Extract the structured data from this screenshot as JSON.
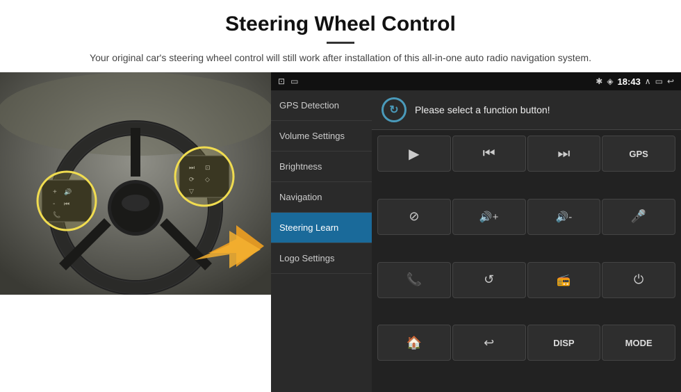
{
  "page": {
    "title": "Steering Wheel Control",
    "divider": true,
    "description": "Your original car's steering wheel control will still work after installation of this all-in-one auto radio navigation system."
  },
  "status_bar": {
    "left_icons": [
      "⊡",
      "⬜"
    ],
    "bluetooth_icon": "⚡",
    "wifi_icon": "◈",
    "time": "18:43",
    "up_icon": "∧",
    "battery_icon": "▭",
    "back_icon": "↩"
  },
  "sidebar": {
    "items": [
      {
        "label": "GPS Detection",
        "active": false
      },
      {
        "label": "Volume Settings",
        "active": false
      },
      {
        "label": "Brightness",
        "active": false
      },
      {
        "label": "Navigation",
        "active": false
      },
      {
        "label": "Steering Learn",
        "active": true
      },
      {
        "label": "Logo Settings",
        "active": false
      }
    ]
  },
  "function_panel": {
    "header_text": "Please select a function button!",
    "refresh_symbol": "↻",
    "buttons": [
      {
        "symbol": "▶",
        "type": "icon"
      },
      {
        "symbol": "⏮",
        "type": "icon"
      },
      {
        "symbol": "⏭",
        "type": "icon"
      },
      {
        "symbol": "GPS",
        "type": "text"
      },
      {
        "symbol": "🚫",
        "type": "icon"
      },
      {
        "symbol": "🔊+",
        "type": "icon"
      },
      {
        "symbol": "🔊-",
        "type": "icon"
      },
      {
        "symbol": "🎤",
        "type": "icon"
      },
      {
        "symbol": "📞",
        "type": "icon"
      },
      {
        "symbol": "↺",
        "type": "icon"
      },
      {
        "symbol": "📻",
        "type": "icon"
      },
      {
        "symbol": "⏻",
        "type": "icon"
      },
      {
        "symbol": "🏠",
        "type": "icon"
      },
      {
        "symbol": "↩",
        "type": "icon"
      },
      {
        "symbol": "DISP",
        "type": "text"
      },
      {
        "symbol": "MODE",
        "type": "text"
      }
    ]
  }
}
